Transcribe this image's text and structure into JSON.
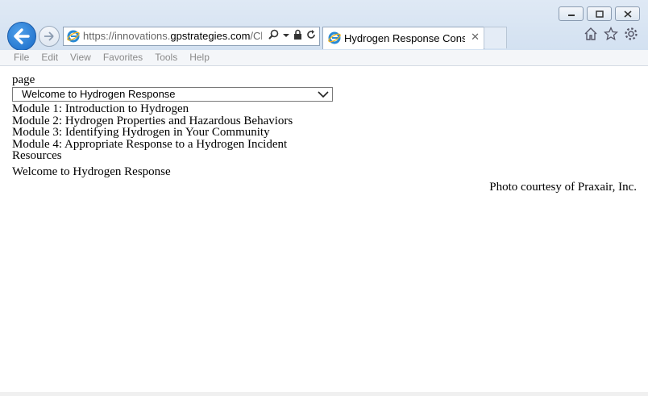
{
  "browser": {
    "url_prefix": "https://innovations.",
    "url_host": "gpstrategies.com",
    "url_suffix": "/Clie",
    "tab_title": "Hydrogen Response Consi...",
    "window_buttons": [
      "minimize-icon",
      "maximize-icon",
      "close-icon"
    ],
    "menu": [
      "File",
      "Edit",
      "View",
      "Favorites",
      "Tools",
      "Help"
    ]
  },
  "page": {
    "label": "page",
    "select_value": "Welcome to Hydrogen Response",
    "modules": [
      "Module 1: Introduction to Hydrogen",
      "Module 2: Hydrogen Properties and Hazardous Behaviors",
      "Module 3: Identifying Hydrogen in Your Community",
      "Module 4: Appropriate Response to a Hydrogen Incident",
      "Resources"
    ],
    "welcome": "Welcome to Hydrogen Response",
    "photo_credit": "Photo courtesy of Praxair, Inc."
  },
  "colors": {
    "chrome_bg": "#dfe9f5",
    "back_button": "#1769c7",
    "ie_logo": "#2a8ad4",
    "ie_ring": "#f2b21b"
  }
}
